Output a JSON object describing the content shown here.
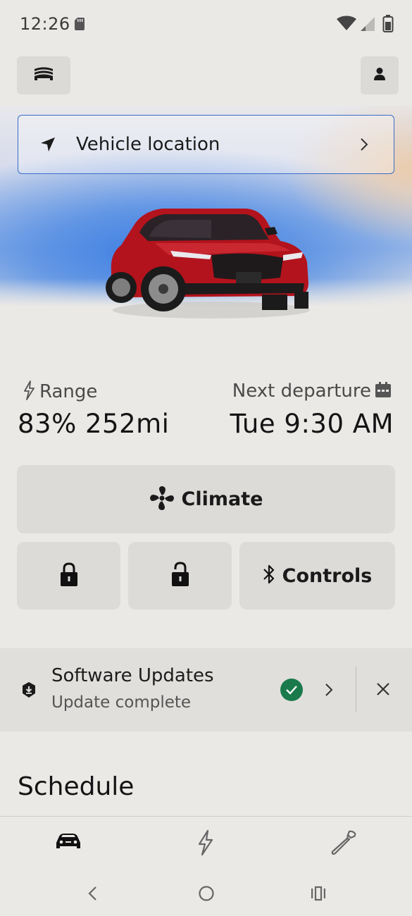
{
  "status_bar": {
    "time": "12:26"
  },
  "header": {
    "garage_icon": "garage-stack-icon",
    "profile_icon": "person-icon"
  },
  "location": {
    "label": "Vehicle location"
  },
  "range": {
    "label": "Range",
    "value": "83% 252mi"
  },
  "departure": {
    "label": "Next departure",
    "value": "Tue 9:30 AM"
  },
  "climate": {
    "label": "Climate"
  },
  "controls": {
    "label": "Controls"
  },
  "software_updates": {
    "title": "Software Updates",
    "status": "Update complete",
    "status_color": "#1a7a4c"
  },
  "schedule": {
    "heading": "Schedule"
  },
  "colors": {
    "accent_border": "#3a6cc8",
    "background": "#ebe9e6",
    "tile": "#dddbd8"
  }
}
